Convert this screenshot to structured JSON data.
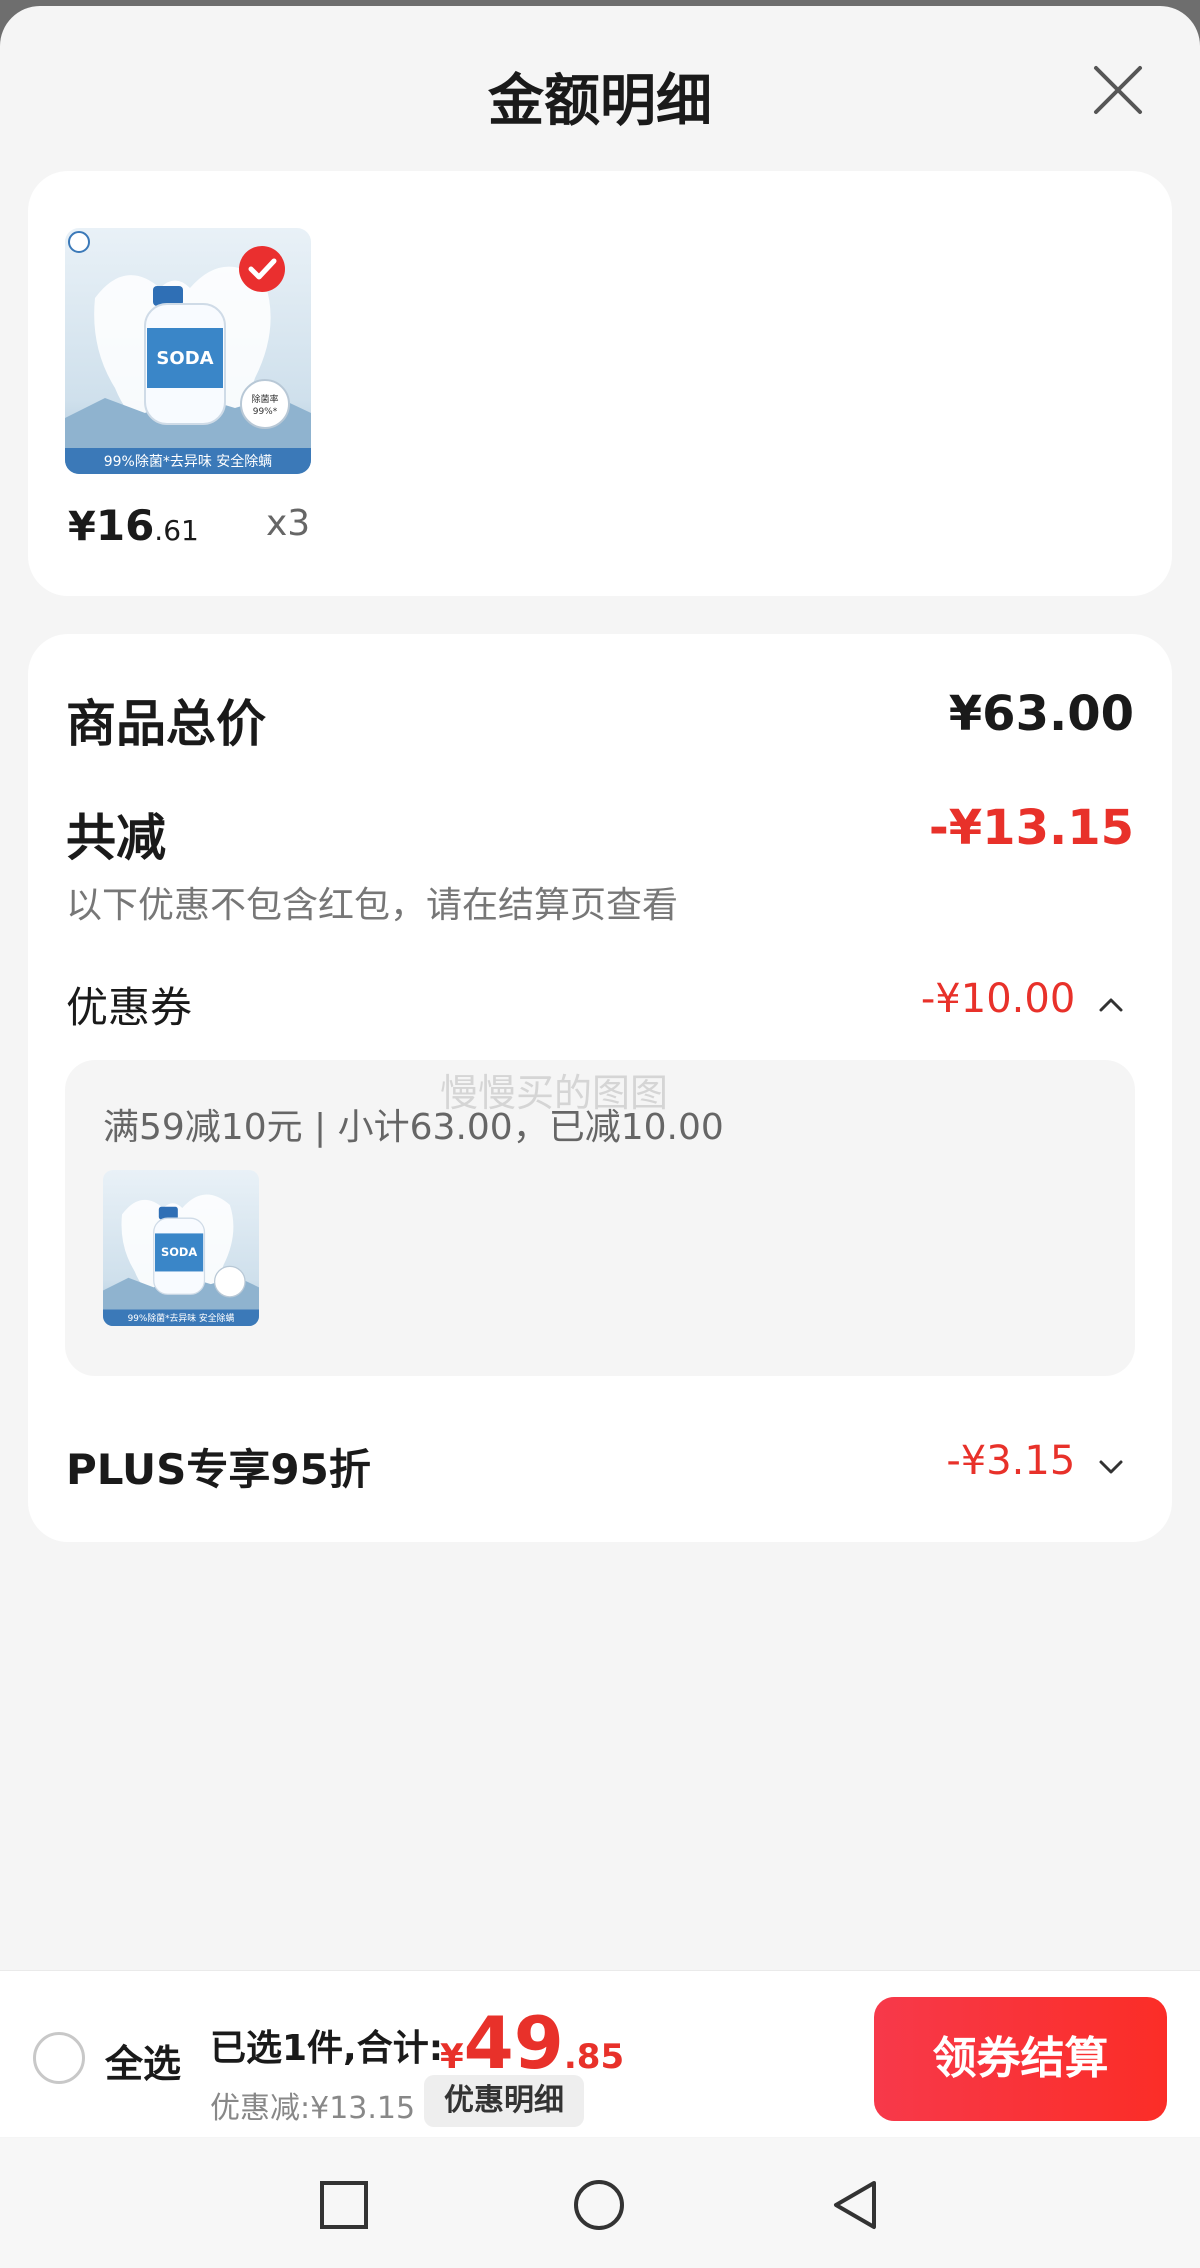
{
  "header": {
    "title": "金额明细"
  },
  "product": {
    "price_currency": "¥",
    "price_int": "16",
    "price_dec": ".61",
    "quantity": "x3"
  },
  "summary": {
    "goods_total_label": "商品总价",
    "goods_total_value": "¥63.00",
    "total_discount_label": "共减",
    "total_discount_value": "-¥13.15",
    "note": "以下优惠不包含红包，请在结算页查看",
    "coupon_label": "优惠券",
    "coupon_value": "-¥10.00",
    "coupon_detail": "满59减10元 | 小计63.00，已减10.00",
    "plus_label": "PLUS专享95折",
    "plus_value": "-¥3.15"
  },
  "watermark": "慢慢买的图图",
  "bottom": {
    "select_all": "全选",
    "selected_summary": "已选1件,合计:",
    "total_currency": "¥",
    "total_int": "49",
    "total_dec": ".85",
    "discount_text": "优惠减:¥13.15",
    "detail_button": "优惠明细",
    "checkout_button": "领券结算"
  },
  "product_image": {
    "brand": "SODA",
    "caption": "99%除菌*去异味 安全除螨",
    "badge": "除菌率 99%*"
  },
  "colors": {
    "accent_red": "#e8312a",
    "checkout_red": "#fb2d27"
  }
}
